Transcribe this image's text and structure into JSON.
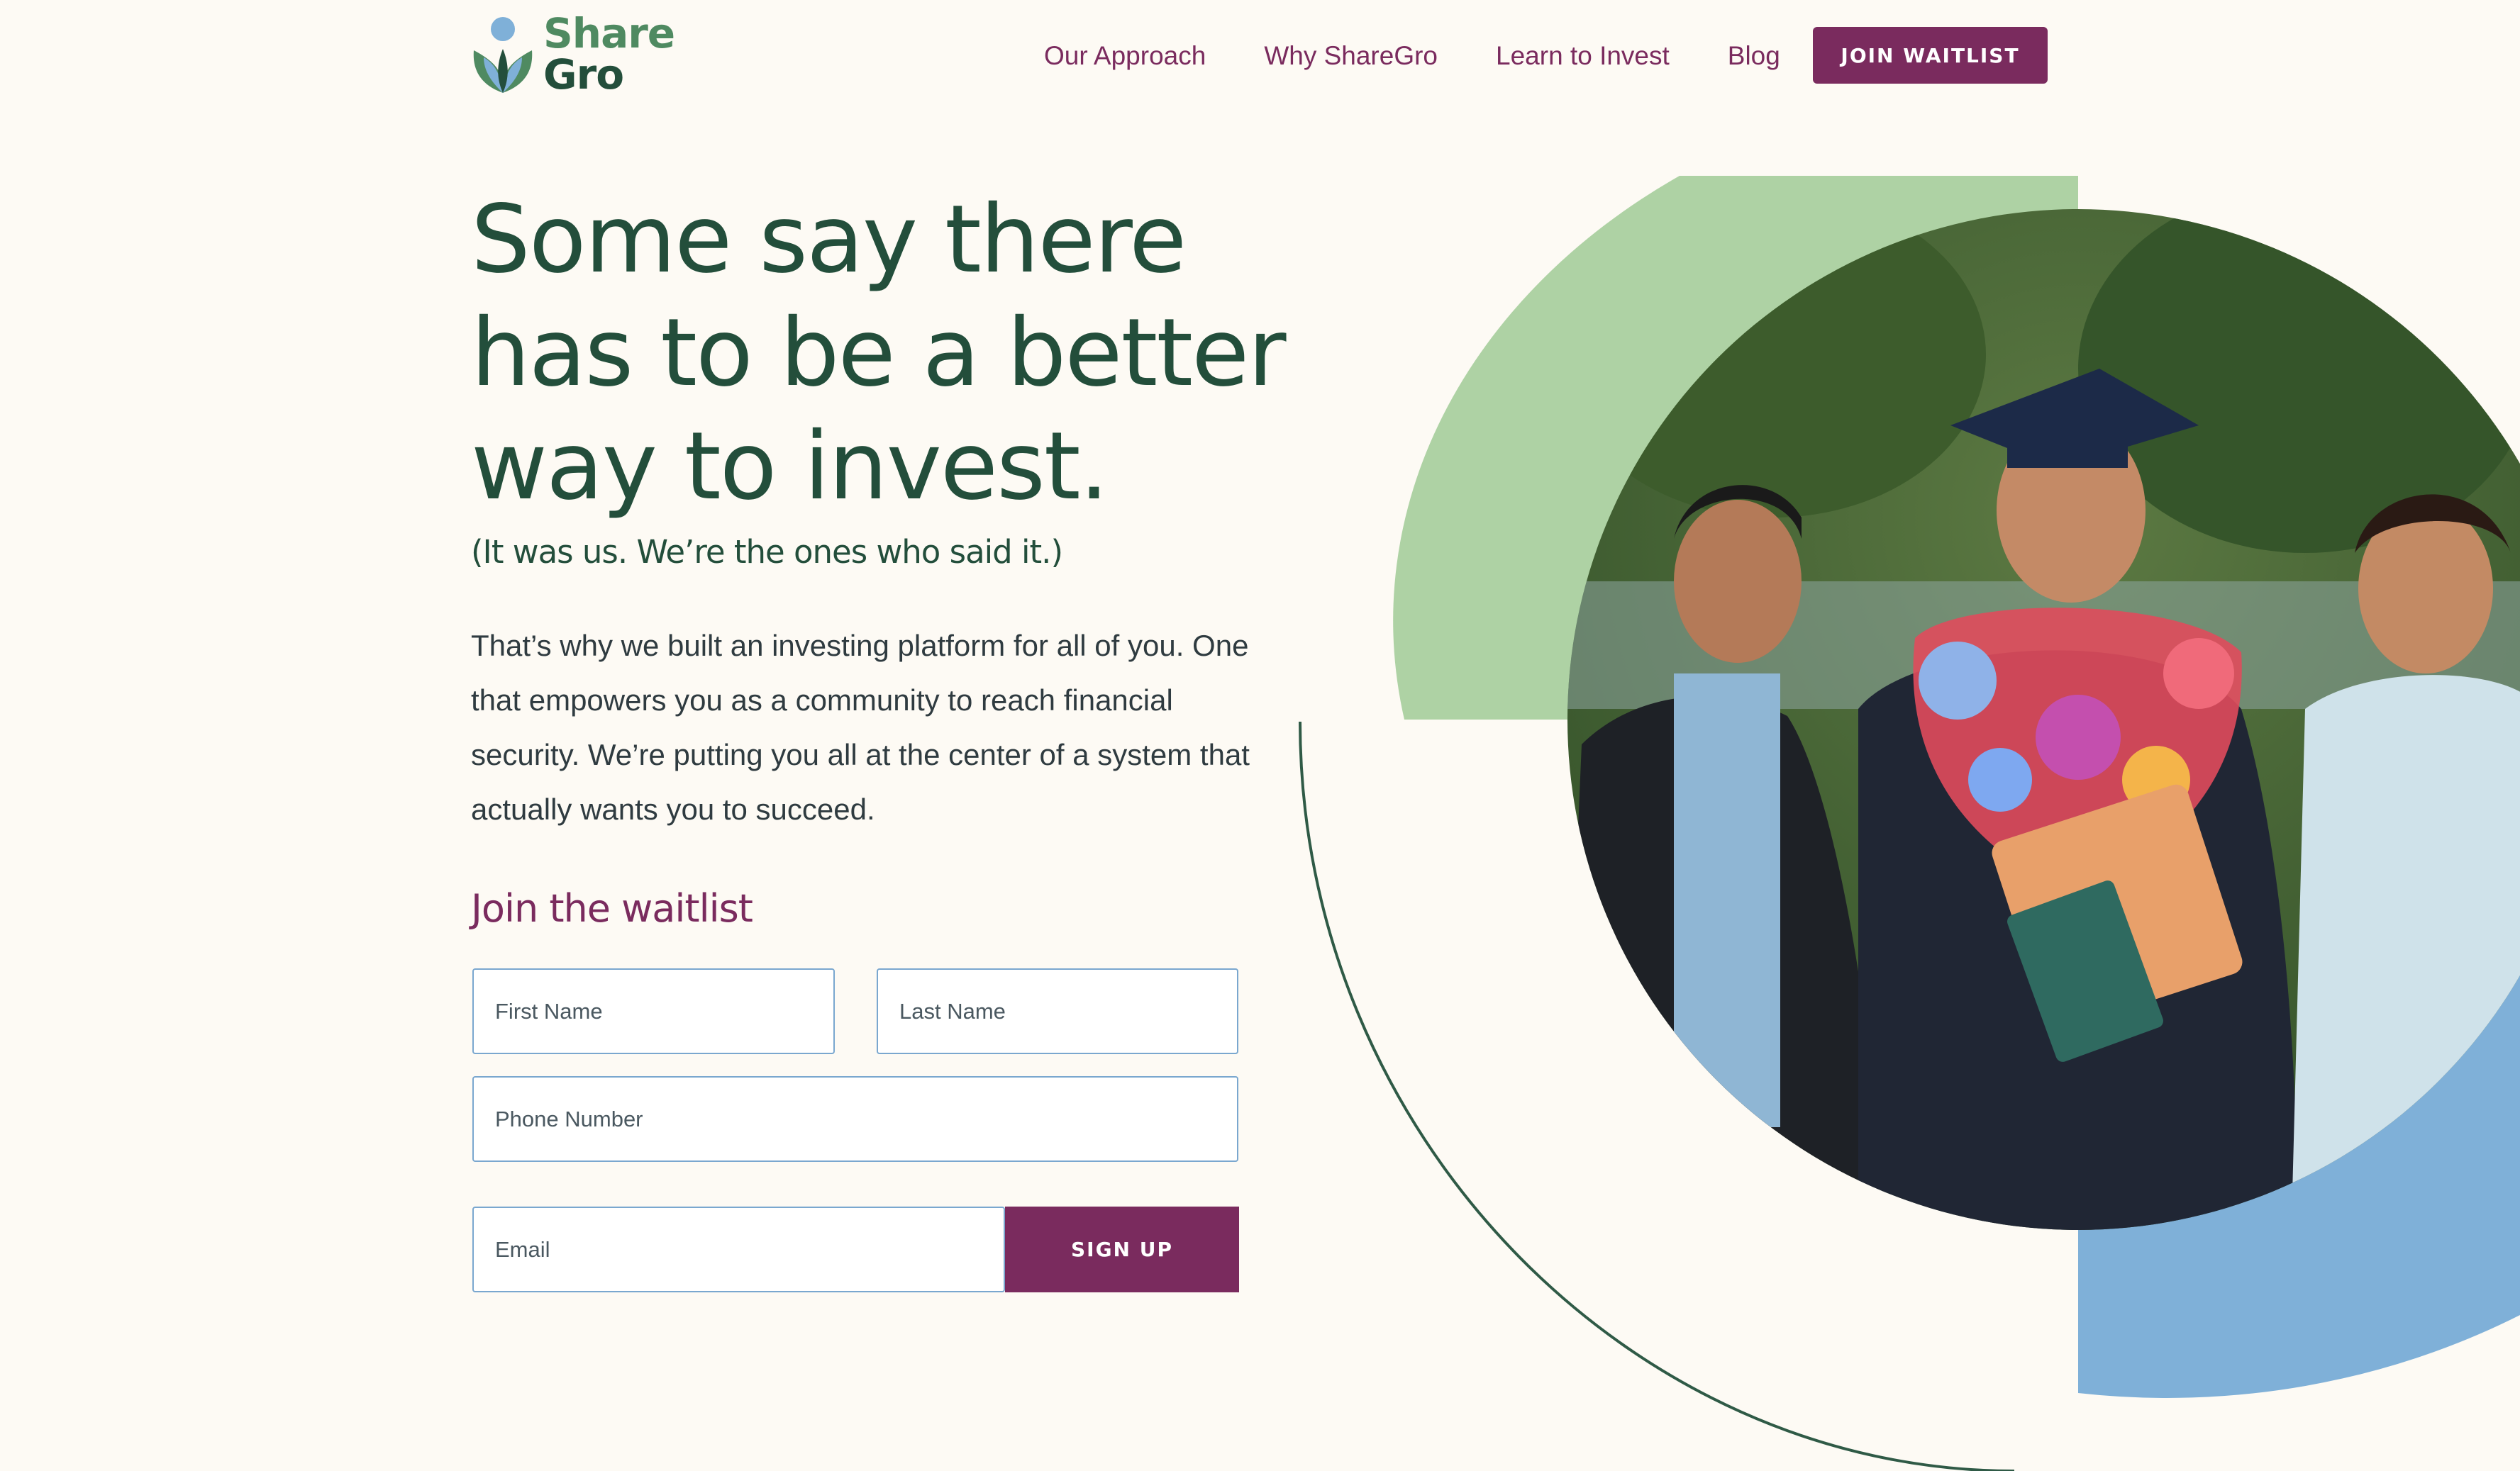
{
  "brand": {
    "name_top": "Share",
    "name_bottom": "Gro"
  },
  "nav": {
    "items": [
      {
        "label": "Our Approach"
      },
      {
        "label": "Why ShareGro"
      },
      {
        "label": "Learn to Invest"
      },
      {
        "label": "Blog"
      }
    ],
    "cta_label": "JOIN WAITLIST"
  },
  "hero": {
    "title": "Some say there has to be a better way to invest.",
    "subtitle": "(It was us. We’re the ones who said it.)",
    "body": "That’s why we built an investing platform for all of you. One that empowers you as a community to reach financial security. We’re putting you all at the center of a system that actually wants you to succeed."
  },
  "waitlist": {
    "heading": "Join the waitlist",
    "first_name_placeholder": "First Name",
    "last_name_placeholder": "Last Name",
    "phone_placeholder": "Phone Number",
    "email_placeholder": "Email",
    "submit_label": "SIGN UP"
  },
  "colors": {
    "background": "#fdfaf4",
    "brand_green": "#234e3b",
    "light_green": "#aed2a4",
    "accent_purple": "#7a2b5e",
    "accent_blue": "#7fb0d8"
  },
  "icons": {
    "logo": "sprout-logo-icon"
  }
}
